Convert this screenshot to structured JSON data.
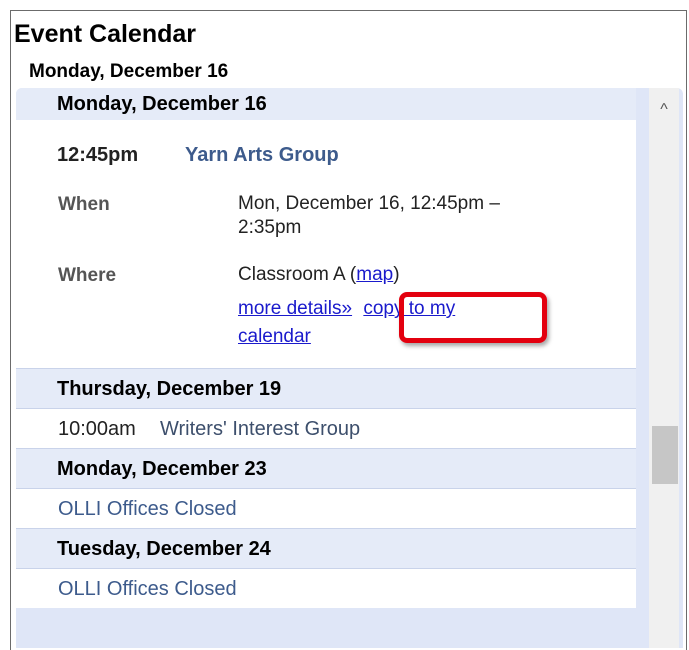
{
  "header": {
    "title": "Event Calendar",
    "date": "Monday, December 16"
  },
  "agenda": {
    "first_day": {
      "header": "Monday, December 16",
      "event": {
        "time": "12:45pm",
        "name": "Yarn Arts Group",
        "when_label": "When",
        "when_line1": "Mon, December 16, 12:45pm –",
        "when_line2": "2:35pm",
        "where_label": "Where",
        "where_value": "Classroom A (",
        "map_link": "map",
        "where_close": ")",
        "more_details": "more details»",
        "copy_line1": "copy to my",
        "copy_line2": "calendar"
      }
    },
    "days": [
      {
        "header": "Thursday, December 19",
        "time": "10:00am",
        "name": "Writers' Interest Group"
      },
      {
        "header": "Monday, December 23",
        "name": "OLLI Offices Closed"
      },
      {
        "header": "Tuesday, December 24",
        "name": "OLLI Offices Closed"
      }
    ]
  },
  "scrollbar": {
    "up_arrow": "^"
  },
  "colors": {
    "highlight": "#e3000f",
    "link": "#1a1acc",
    "header_bg": "#e5ebf8"
  }
}
